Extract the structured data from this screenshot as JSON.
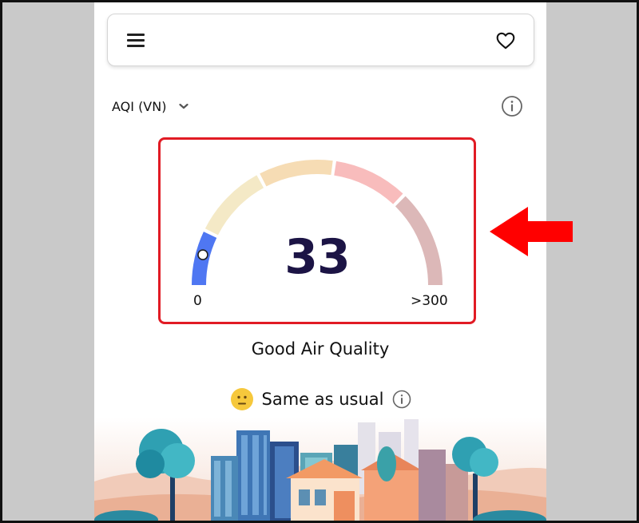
{
  "header": {
    "menu_icon": "hamburger-menu-icon",
    "favorite_icon": "heart-outline-icon"
  },
  "aqi_selector": {
    "label": "AQI (VN)",
    "icon": "chevron-down-icon"
  },
  "info_icon": "info-circle-icon",
  "gauge": {
    "value": "33",
    "min_label": "0",
    "max_label": ">300",
    "indicator_level": 33,
    "scale_max": 300,
    "segment_colors": [
      "#4f77f2",
      "#f4e9c6",
      "#f6dcb4",
      "#f8bcbc",
      "#dcb8b8"
    ],
    "border_color": "#e11b24"
  },
  "quality_label": "Good Air Quality",
  "status": {
    "emoji": "neutral-face-emoji",
    "text": "Same as usual",
    "info_icon": "info-circle-icon"
  },
  "illustration": "city-skyline-illustration",
  "annotation": {
    "arrow": "red-arrow-pointing-left",
    "color": "#ff0000"
  }
}
